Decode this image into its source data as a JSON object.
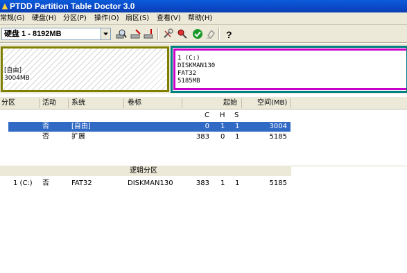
{
  "window": {
    "title": "PTDD Partition Table Doctor 3.0",
    "icon": "app-logo-icon"
  },
  "menu": [
    "常规(G)",
    "硬盘(H)",
    "分区(P)",
    "操作(O)",
    "扇区(S)",
    "查看(V)",
    "帮助(H)"
  ],
  "toolbar": {
    "disk_selected": "硬盘 1 - 8192MB",
    "buttons": [
      "disk-search-icon",
      "disk-edit-icon",
      "disk-write-icon",
      "tools-icon",
      "zoom-icon",
      "apply-icon",
      "undo-icon",
      "help-icon"
    ]
  },
  "disk_map": {
    "free_block": {
      "line1": "[自由]",
      "line2": "3004MB"
    },
    "extended_block": {
      "line1": "1 (C:)",
      "line2": "DISKMAN130",
      "line3": "FAT32",
      "line4": "5185MB"
    }
  },
  "table": {
    "columns": {
      "partition": "分区",
      "active": "活动",
      "system": "系统",
      "label": "卷标",
      "start": "起始",
      "space": "空间(MB)"
    },
    "chs": {
      "c": "C",
      "h": "H",
      "s": "S"
    },
    "rows": [
      {
        "partition": "",
        "active": "否",
        "system": "[自由]",
        "label": "",
        "c": "0",
        "h": "1",
        "s": "1",
        "space": "3004"
      },
      {
        "partition": "",
        "active": "否",
        "system": "扩展",
        "label": "",
        "c": "383",
        "h": "0",
        "s": "1",
        "space": "5185"
      }
    ],
    "logical_header": "逻辑分区",
    "logical_rows": [
      {
        "partition": "1 (C:)",
        "active": "否",
        "system": "FAT32",
        "label": "DISKMAN130",
        "c": "383",
        "h": "1",
        "s": "1",
        "space": "5185"
      }
    ]
  },
  "colors": {
    "title_bar": "#0a49c7",
    "selection": "#316ac5",
    "free_border": "#808000",
    "ext_outer": "#008080",
    "ext_inner": "#c800c8"
  }
}
